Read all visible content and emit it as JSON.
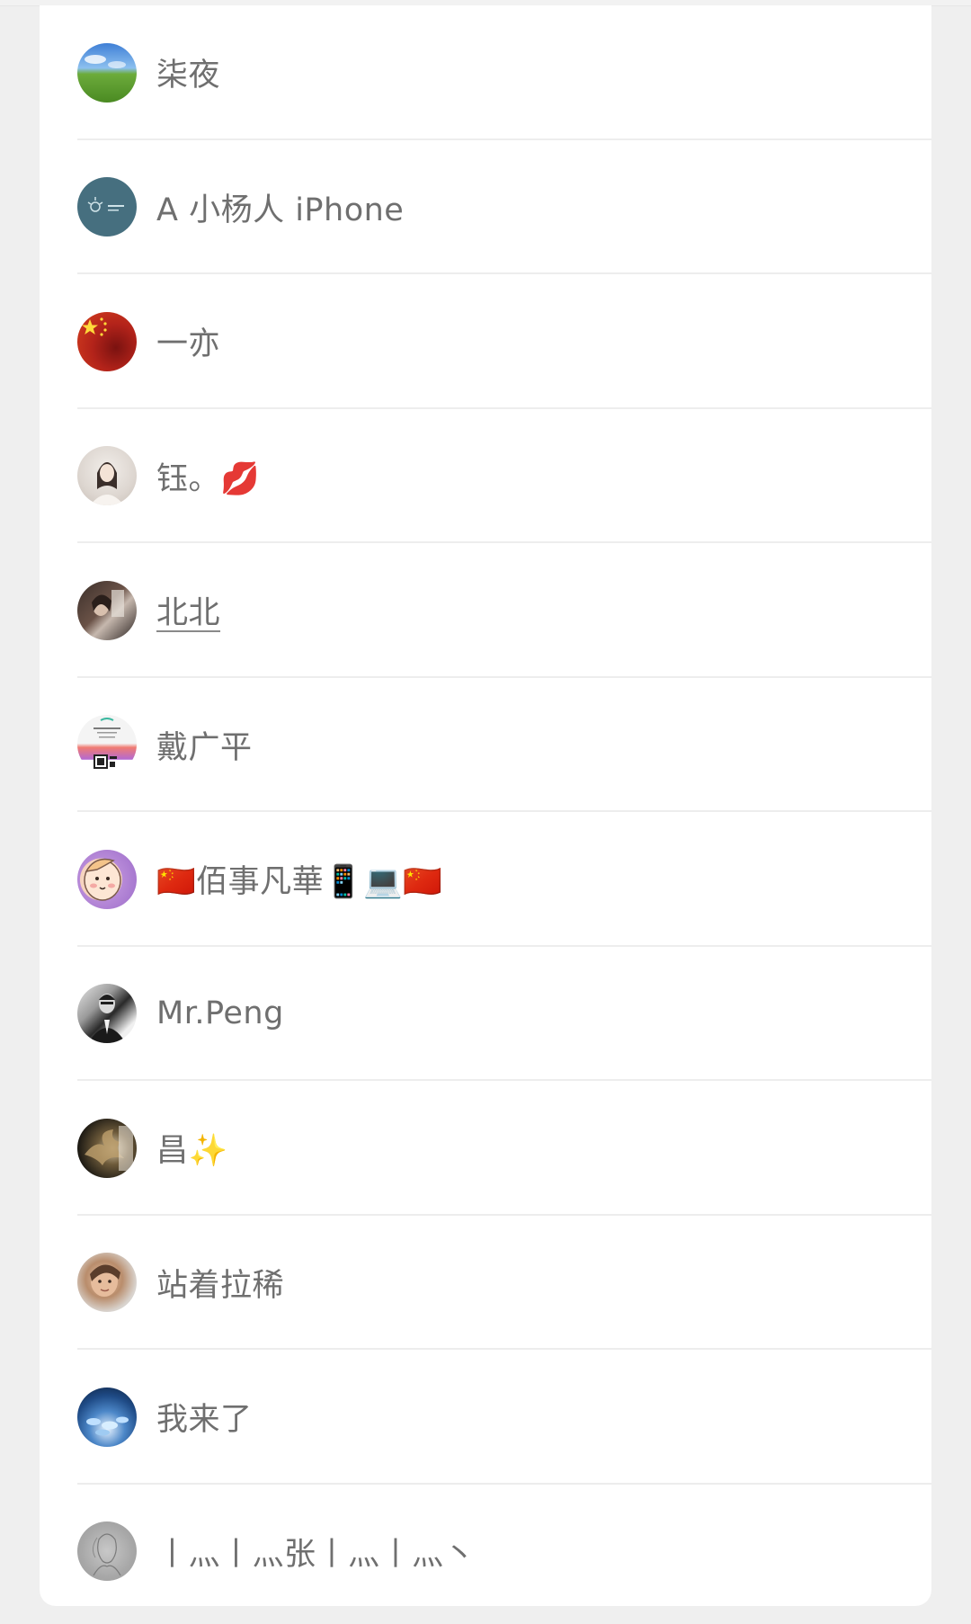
{
  "contacts": [
    {
      "name": "柒夜",
      "avatar": "landscape-hills-avatar"
    },
    {
      "name": "A 小杨人 iPhone",
      "avatar": "teal-logo-avatar"
    },
    {
      "name": "一亦",
      "avatar": "china-flag-avatar"
    },
    {
      "name": "钰。💋",
      "avatar": "girl-portrait-avatar"
    },
    {
      "name": "北北",
      "avatar": "couple-photo-avatar"
    },
    {
      "name": "戴广平",
      "avatar": "qr-poster-avatar"
    },
    {
      "name": "🇨🇳佰事凡華📱💻🇨🇳",
      "avatar": "cartoon-avatar"
    },
    {
      "name": "Mr.Peng",
      "avatar": "bw-portrait-avatar"
    },
    {
      "name": "昌✨",
      "avatar": "dark-scene-avatar"
    },
    {
      "name": "站着拉稀",
      "avatar": "face-photo-avatar"
    },
    {
      "name": "我来了",
      "avatar": "water-scene-avatar"
    },
    {
      "name": "丨灬丨灬张丨灬丨灬丶",
      "avatar": "sketch-avatar"
    }
  ],
  "colors": {
    "background": "#efefef",
    "card": "#ffffff",
    "divider": "#ededed",
    "text": "#6f6f6f"
  }
}
